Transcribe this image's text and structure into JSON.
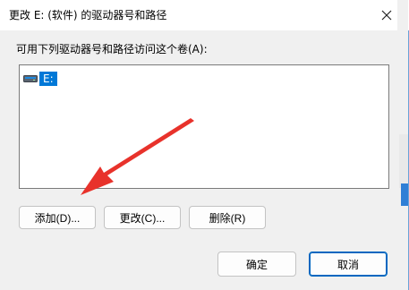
{
  "dialog": {
    "title": "更改 E: (软件) 的驱动器号和路径",
    "prompt": "可用下列驱动器号和路径访问这个卷(A):",
    "volumes": [
      {
        "label": "E:",
        "icon": "drive-icon",
        "selected": true
      }
    ],
    "buttons": {
      "add": "添加(D)...",
      "change": "更改(C)...",
      "remove": "删除(R)",
      "ok": "确定",
      "cancel": "取消"
    }
  },
  "colors": {
    "selection": "#0078d7",
    "arrow": "#e8322b",
    "focus_border": "#0067c0"
  }
}
